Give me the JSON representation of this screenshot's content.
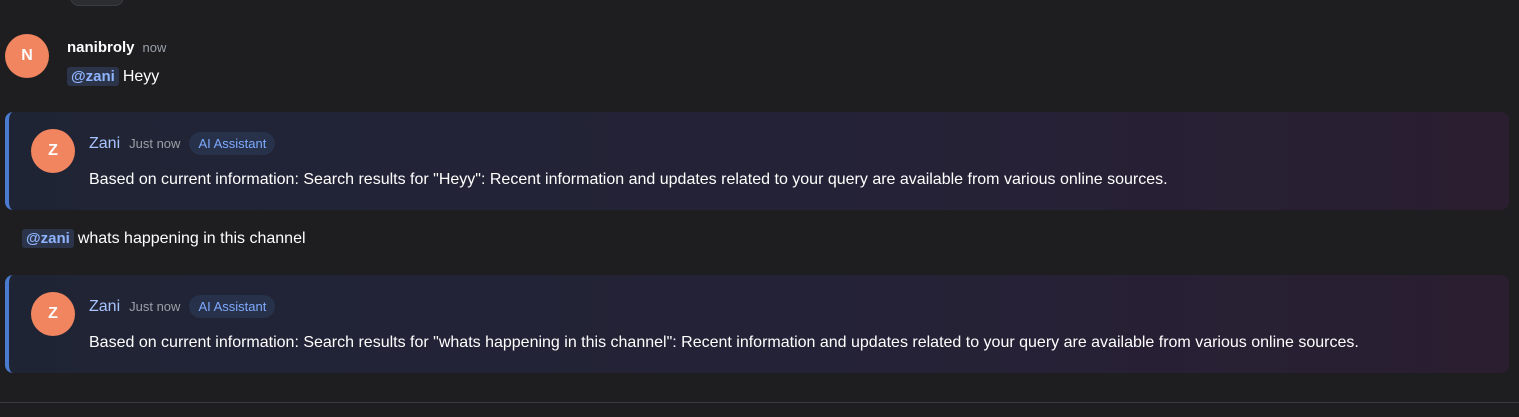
{
  "messages": {
    "user": {
      "avatar_letter": "N",
      "username": "nanibroly",
      "time": "now",
      "mention": "@zani",
      "text": "Heyy"
    },
    "ai_1": {
      "avatar_letter": "Z",
      "name": "Zani",
      "time": "Just now",
      "badge": "AI Assistant",
      "text": "Based on current information: Search results for \"Heyy\": Recent information and updates related to your query are available from various online sources."
    },
    "followup": {
      "mention": "@zani",
      "text": "whats happening in this channel"
    },
    "ai_2": {
      "avatar_letter": "Z",
      "name": "Zani",
      "time": "Just now",
      "badge": "AI Assistant",
      "text": "Based on current information: Search results for \"whats happening in this channel\": Recent information and updates related to your query are available from various online sources."
    }
  },
  "colors": {
    "background": "#1e1e20",
    "avatar": "#f0855f",
    "accent_border": "#4a7bd0",
    "mention_text": "#8fb4ff",
    "badge_text": "#7eaaff"
  }
}
